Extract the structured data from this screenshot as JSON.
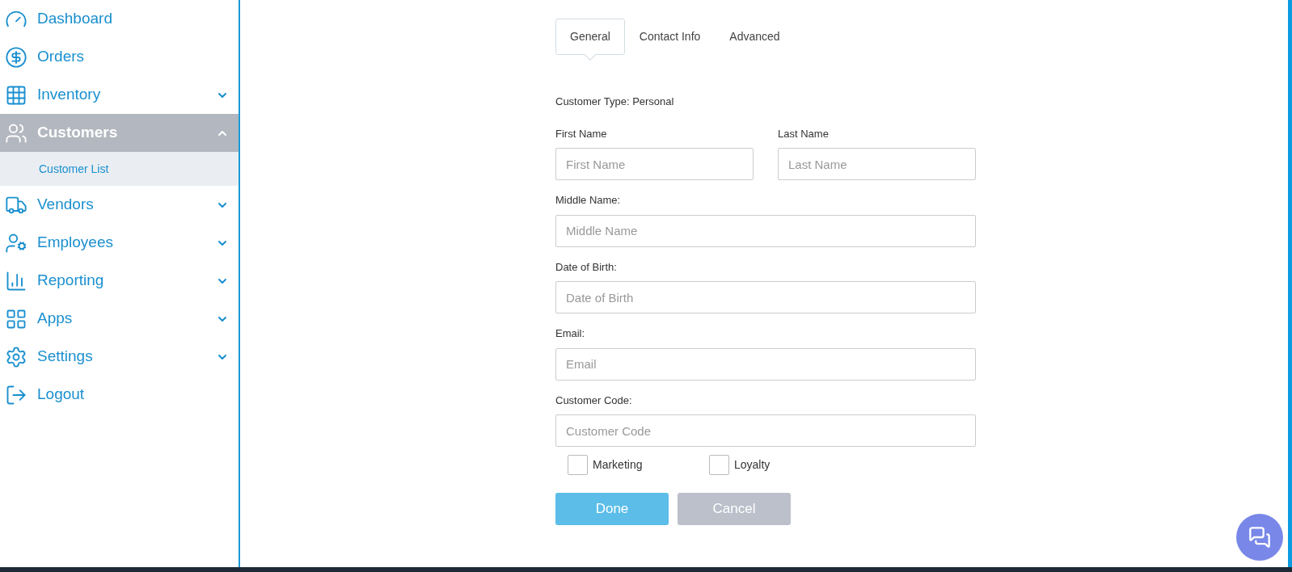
{
  "sidebar": {
    "items": [
      {
        "label": "Dashboard",
        "kind": "link",
        "selected": false
      },
      {
        "label": "Orders",
        "kind": "link",
        "selected": false
      },
      {
        "label": "Inventory",
        "kind": "group",
        "selected": false,
        "expanded": false
      },
      {
        "label": "Customers",
        "kind": "group",
        "selected": true,
        "expanded": true,
        "children": [
          {
            "label": "Customer List",
            "selected": false
          }
        ]
      },
      {
        "label": "Vendors",
        "kind": "group",
        "selected": false,
        "expanded": false
      },
      {
        "label": "Employees",
        "kind": "group",
        "selected": false,
        "expanded": false
      },
      {
        "label": "Reporting",
        "kind": "group",
        "selected": false,
        "expanded": false
      },
      {
        "label": "Apps",
        "kind": "group",
        "selected": false,
        "expanded": false
      },
      {
        "label": "Settings",
        "kind": "group",
        "selected": false,
        "expanded": false
      },
      {
        "label": "Logout",
        "kind": "link",
        "selected": false
      }
    ]
  },
  "tabs": [
    {
      "label": "General",
      "selected": true
    },
    {
      "label": "Contact Info",
      "selected": false
    },
    {
      "label": "Advanced",
      "selected": false
    }
  ],
  "customer_type": "Customer Type: Personal",
  "name_fields": [
    {
      "label": "First Name",
      "placeholder": "First Name"
    },
    {
      "label": "Last Name",
      "placeholder": "Last Name"
    }
  ],
  "fields": [
    {
      "label": "Middle Name:",
      "placeholder": "Middle Name"
    },
    {
      "label": "Date of Birth:",
      "placeholder": "Date of Birth"
    },
    {
      "label": "Email:",
      "placeholder": "Email"
    },
    {
      "label": "Customer Code:",
      "placeholder": "Customer Code"
    }
  ],
  "checkboxes": [
    {
      "label": "Marketing",
      "checked": false
    },
    {
      "label": "Loyalty",
      "checked": false
    }
  ],
  "buttons": [
    {
      "label": "Done",
      "kind": "primary"
    },
    {
      "label": "Cancel",
      "kind": "secondary"
    }
  ]
}
